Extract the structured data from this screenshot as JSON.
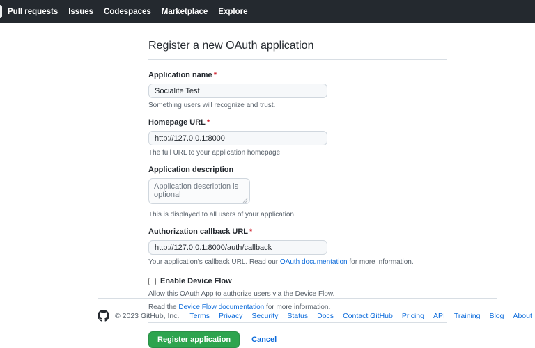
{
  "nav": {
    "items": [
      "Pull requests",
      "Issues",
      "Codespaces",
      "Marketplace",
      "Explore"
    ]
  },
  "page": {
    "title": "Register a new OAuth application"
  },
  "form": {
    "required_marker": "*",
    "fields": {
      "app_name": {
        "label": "Application name",
        "value": "Socialite Test",
        "note": "Something users will recognize and trust."
      },
      "homepage_url": {
        "label": "Homepage URL",
        "value": "http://127.0.0.1:8000",
        "note": "The full URL to your application homepage."
      },
      "description": {
        "label": "Application description",
        "placeholder": "Application description is optional",
        "note": "This is displayed to all users of your application."
      },
      "callback_url": {
        "label": "Authorization callback URL",
        "value": "http://127.0.0.1:8000/auth/callback",
        "note_prefix": "Your application's callback URL. Read our ",
        "note_link": "OAuth documentation",
        "note_suffix": " for more information."
      }
    },
    "device_flow": {
      "label": "Enable Device Flow",
      "note1": "Allow this OAuth App to authorize users via the Device Flow.",
      "note2_prefix": "Read the ",
      "note2_link": "Device Flow documentation",
      "note2_suffix": " for more information."
    },
    "submit_label": "Register application",
    "cancel_label": "Cancel"
  },
  "footer": {
    "copyright": "© 2023 GitHub, Inc.",
    "links": [
      "Terms",
      "Privacy",
      "Security",
      "Status",
      "Docs",
      "Contact GitHub",
      "Pricing",
      "API",
      "Training",
      "Blog",
      "About"
    ]
  },
  "colors": {
    "header_bg": "#24292f",
    "primary_button": "#2da44e",
    "link": "#0969da",
    "required": "#cf222e",
    "muted_text": "#57606a",
    "input_bg": "#f6f8fa",
    "border": "#d0d7de"
  }
}
